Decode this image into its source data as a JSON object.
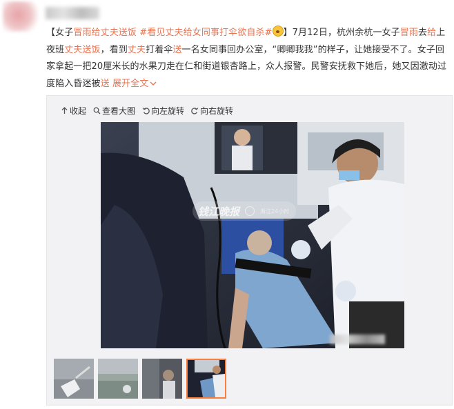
{
  "post": {
    "open_bracket": "【",
    "t1": "女子",
    "k1": "冒雨给丈夫送饭",
    "t2": " ",
    "tag": "#看见丈夫给女同事打伞欲自杀#",
    "t3": "】7月12日，杭州余杭一女子",
    "k2": "冒雨",
    "t4": "去",
    "k3": "给",
    "t5": "上夜班",
    "k4": "丈夫送饭",
    "t6": "，看到",
    "k5": "丈夫",
    "t7": "打着伞",
    "k6": "送",
    "t8": "一名女同事回办公室，“卿卿我我”的样子，让她接受不了。女子回家拿起一把20厘米长的水果刀走在仁和街道银杏路上，众人报警。民警安抚救下她后，她又因激动过度陷入昏迷被",
    "k7": "送",
    "t9": " ",
    "expand": "展开全文",
    "expand_icon": "chevron-down-icon"
  },
  "toolbar": {
    "collapse": "收起",
    "view_large": "查看大图",
    "rotate_left": "向左旋转",
    "rotate_right": "向右旋转"
  },
  "image": {
    "watermark_brand": "钱江晚报",
    "watermark_sub": "浙江24小时"
  },
  "colors": {
    "keyword": "#eb7350",
    "active_thumb_border": "#fa7d3c",
    "panel_bg": "#f2f2f5"
  }
}
